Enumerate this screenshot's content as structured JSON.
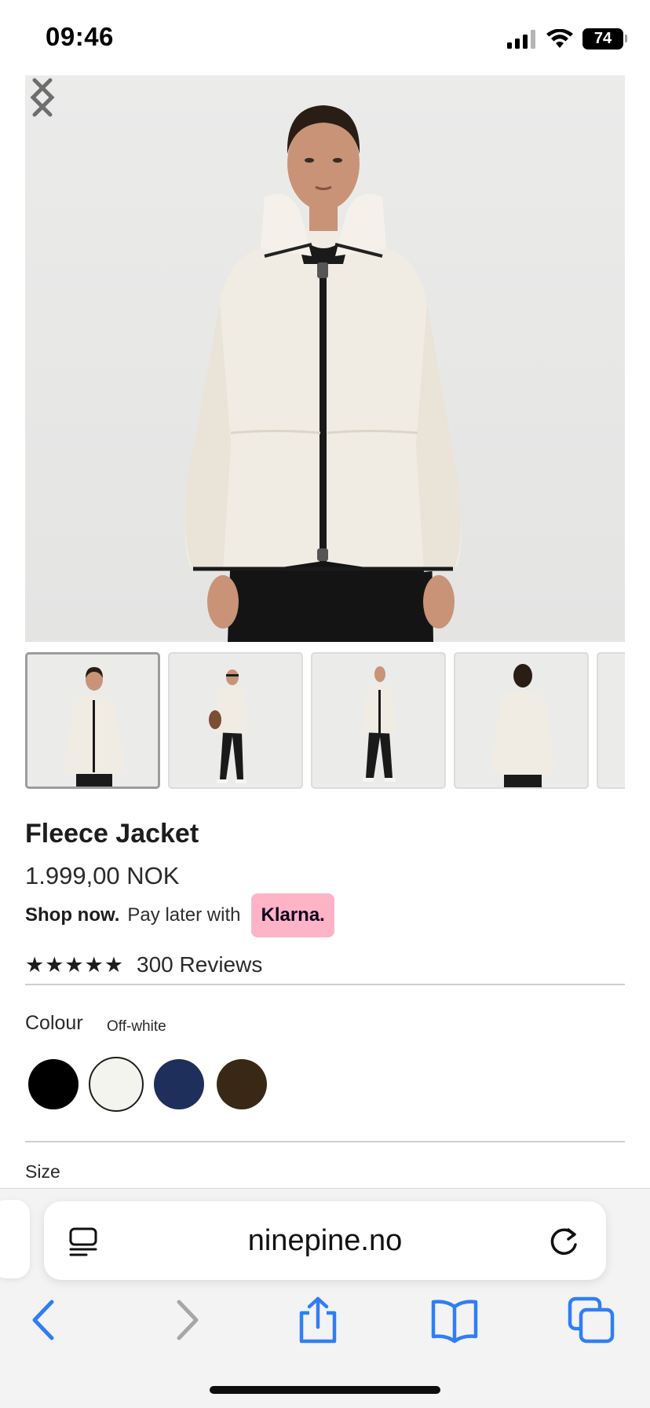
{
  "status_bar": {
    "time": "09:46",
    "battery": "74",
    "icons": [
      "cellular-signal-icon",
      "wifi-icon",
      "battery-icon"
    ]
  },
  "gallery": {
    "main_image": "fleece-jacket-front-photo",
    "prev_icon": "chevron-left-icon",
    "next_icon": "chevron-right-icon",
    "thumbnails": [
      {
        "image": "front-view-thumbnail",
        "selected": true
      },
      {
        "image": "side-view-with-bag-thumbnail",
        "selected": false
      },
      {
        "image": "full-body-front-thumbnail",
        "selected": false
      },
      {
        "image": "back-view-thumbnail",
        "selected": false
      },
      {
        "image": "partial-thumbnail",
        "selected": false
      }
    ]
  },
  "product": {
    "title": "Fleece Jacket",
    "price": "1.999,00 NOK",
    "shop_now": "Shop now.",
    "pay_later": "Pay later with",
    "klarna": "Klarna.",
    "stars": "★★★★★",
    "rating": 5,
    "reviews": "300 Reviews",
    "colour_label": "Colour",
    "colour_value": "Off-white",
    "colours": [
      {
        "name": "black",
        "hex": "#000000",
        "selected": false
      },
      {
        "name": "off-white",
        "hex": "#f4f4ef",
        "selected": true
      },
      {
        "name": "navy",
        "hex": "#1f2f5c",
        "selected": false
      },
      {
        "name": "brown",
        "hex": "#3a2817",
        "selected": false
      }
    ],
    "size_label": "Size"
  },
  "browser": {
    "url": "ninepine.no",
    "accent": "#2f7ef5",
    "toolbar": [
      "back-icon",
      "forward-icon",
      "share-icon",
      "bookmarks-icon",
      "tabs-icon"
    ]
  }
}
